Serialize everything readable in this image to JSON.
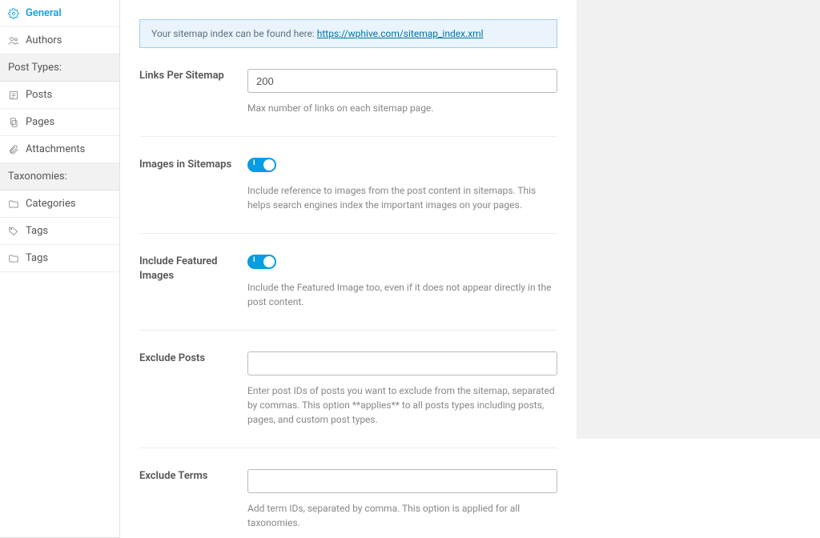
{
  "sidebar": {
    "items": [
      {
        "label": "General",
        "icon": "gear-icon",
        "active": true
      },
      {
        "label": "Authors",
        "icon": "authors-icon",
        "active": false
      }
    ],
    "groupPostTypes": "Post Types:",
    "postTypes": [
      {
        "label": "Posts",
        "icon": "posts-icon"
      },
      {
        "label": "Pages",
        "icon": "pages-icon"
      },
      {
        "label": "Attachments",
        "icon": "attachment-icon"
      }
    ],
    "groupTaxonomies": "Taxonomies:",
    "taxonomies": [
      {
        "label": "Categories",
        "icon": "folder-icon"
      },
      {
        "label": "Tags",
        "icon": "tag-icon"
      },
      {
        "label": "Tags",
        "icon": "folder-icon"
      }
    ]
  },
  "notice": {
    "prefix": "Your sitemap index can be found here: ",
    "link_text": "https://wphive.com/sitemap_index.xml"
  },
  "fields": {
    "linksPerSitemap": {
      "label": "Links Per Sitemap",
      "value": "200",
      "desc": "Max number of links on each sitemap page."
    },
    "imagesInSitemaps": {
      "label": "Images in Sitemaps",
      "desc": "Include reference to images from the post content in sitemaps. This helps search engines index the important images on your pages."
    },
    "includeFeatured": {
      "label": "Include Featured Images",
      "desc": "Include the Featured Image too, even if it does not appear directly in the post content."
    },
    "excludePosts": {
      "label": "Exclude Posts",
      "value": "",
      "desc": "Enter post IDs of posts you want to exclude from the sitemap, separated by commas. This option **applies** to all posts types including posts, pages, and custom post types."
    },
    "excludeTerms": {
      "label": "Exclude Terms",
      "value": "",
      "desc": "Add term IDs, separated by comma. This option is applied for all taxonomies."
    }
  }
}
